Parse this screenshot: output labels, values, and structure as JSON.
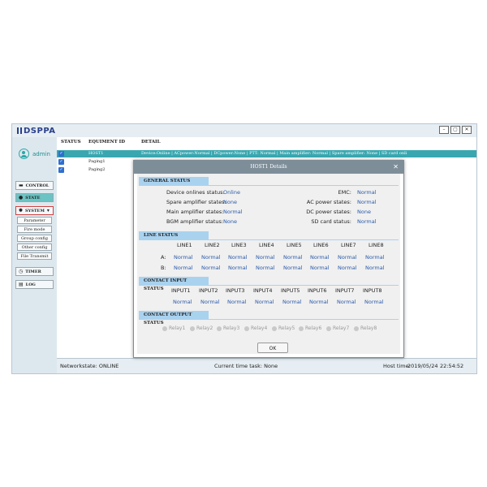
{
  "app": {
    "logo": "DSPPA",
    "window_buttons": [
      "–",
      "▢",
      "✕"
    ],
    "user": "admin"
  },
  "sidebar": {
    "items": [
      {
        "label": "CONTROL",
        "icon": "monitor-icon"
      },
      {
        "label": "STATE",
        "icon": "pin-icon"
      },
      {
        "label": "SYSTEM",
        "icon": "gear-icon"
      },
      {
        "label": "TIMER",
        "icon": "clock-icon"
      },
      {
        "label": "LOG",
        "icon": "book-icon"
      }
    ],
    "subitems": [
      "Parameter",
      "Fire mode",
      "Group config",
      "Other config",
      "File Transmit"
    ]
  },
  "table": {
    "headers": [
      "STATUS",
      "EQUIMENT ID",
      "DETAIL"
    ],
    "rows": [
      {
        "id": "HOST1",
        "detail": "Device:Online | ACpower:Normal | DCpower:None | PTT: Normal | Main amplifier: Normal | Spare amplifier: None | SD card onli"
      },
      {
        "id": "Paging1",
        "detail": ""
      },
      {
        "id": "Paging2",
        "detail": ""
      }
    ]
  },
  "statusbar": {
    "network": "Networkstate: ONLINE",
    "task": "Current time task: None",
    "host_time_label": "Host time:",
    "date": "2019/05/24",
    "time": "22:54:52"
  },
  "dialog": {
    "title": "HOST1 Details",
    "general_title": "GENERAL STATUS",
    "general_left": [
      {
        "label": "Device onlines status:",
        "value": "Online"
      },
      {
        "label": "Spare amplifier states:",
        "value": "None"
      },
      {
        "label": "Main amplifier states:",
        "value": "Normal"
      },
      {
        "label": "BGM amplifier status:",
        "value": "None"
      }
    ],
    "general_right": [
      {
        "label": "EMC:",
        "value": "Normal"
      },
      {
        "label": "AC power states:",
        "value": "Normal"
      },
      {
        "label": "DC power states:",
        "value": "None"
      },
      {
        "label": "SD card status:",
        "value": "Normal"
      }
    ],
    "line_title": "LINE STATUS",
    "lines": [
      "LINE1",
      "LINE2",
      "LINE3",
      "LINE4",
      "LINE5",
      "LINE6",
      "LINE7",
      "LINE8"
    ],
    "row_a_label": "A:",
    "row_b_label": "B:",
    "line_a": [
      "Normal",
      "Normal",
      "Normal",
      "Normal",
      "Normal",
      "Normal",
      "Normal",
      "Normal"
    ],
    "line_b": [
      "Normal",
      "Normal",
      "Normal",
      "Normal",
      "Normal",
      "Normal",
      "Normal",
      "Normal"
    ],
    "input_title": "CONTACT INPUT STATUS",
    "inputs": [
      "INPUT1",
      "INPUT2",
      "INPUT3",
      "INPUT4",
      "INPUT5",
      "INPUT6",
      "INPUT7",
      "INPUT8"
    ],
    "input_values": [
      "Normal",
      "Normal",
      "Normal",
      "Normal",
      "Normal",
      "Normal",
      "Normal",
      "Normal"
    ],
    "output_title": "CONTACT OUTPUT STATUS",
    "relays": [
      "Relay1",
      "Relay2",
      "Relay3",
      "Relay4",
      "Relay5",
      "Relay6",
      "Relay7",
      "Relay8"
    ],
    "ok_label": "OK"
  },
  "colors": {
    "accent": "#3aa7b0",
    "value_text": "#2b5aa8",
    "section_bg": "#a9d2ef"
  }
}
